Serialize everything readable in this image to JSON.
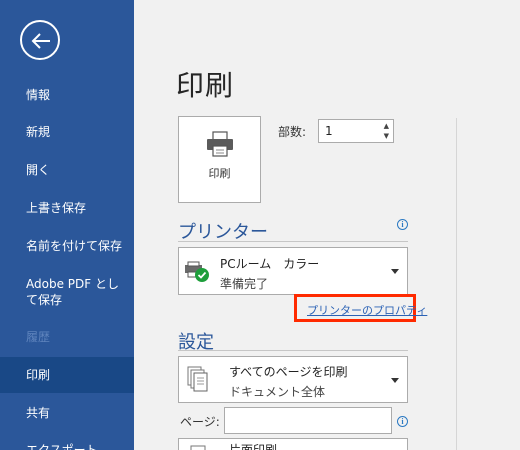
{
  "sidebar": {
    "items": [
      {
        "label": "情報"
      },
      {
        "label": "新規"
      },
      {
        "label": "開く"
      },
      {
        "label": "上書き保存"
      },
      {
        "label": "名前を付けて保存"
      },
      {
        "label": "Adobe PDF として保存"
      },
      {
        "label": "履歴"
      },
      {
        "label": "印刷"
      },
      {
        "label": "共有"
      },
      {
        "label": "エクスポート"
      }
    ]
  },
  "main": {
    "title": "印刷",
    "print_button_label": "印刷",
    "copies_label": "部数:",
    "copies_value": "1",
    "printer": {
      "heading": "プリンター",
      "name": "PCルーム　カラー",
      "status": "準備完了",
      "properties_link": "プリンターのプロパティ"
    },
    "settings": {
      "heading": "設定",
      "range_title": "すべてのページを印刷",
      "range_subtitle": "ドキュメント全体",
      "pages_label": "ページ:",
      "pages_value": "",
      "sides_title": "片面印刷"
    }
  },
  "colors": {
    "sidebar_bg": "#2b579a",
    "sidebar_active": "#194886",
    "accent": "#2b579a",
    "highlight_border": "#ff2a00",
    "ready_green": "#1e9e3b"
  }
}
